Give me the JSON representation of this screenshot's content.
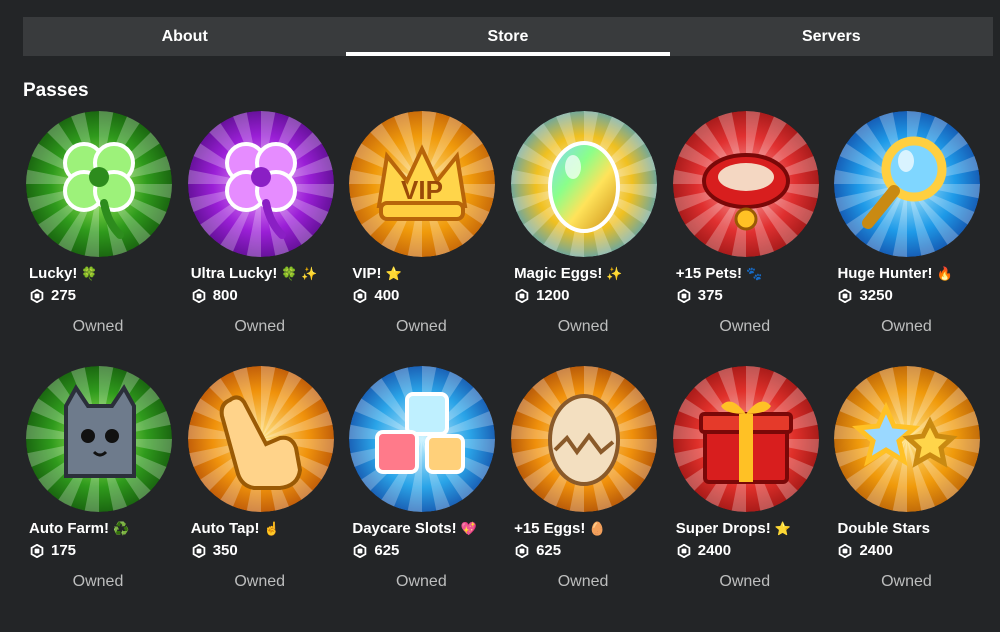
{
  "tabs": [
    {
      "label": "About",
      "active": false
    },
    {
      "label": "Store",
      "active": true
    },
    {
      "label": "Servers",
      "active": false
    }
  ],
  "section_title": "Passes",
  "currency_icon": "robux-icon",
  "owned_label": "Owned",
  "passes": [
    {
      "name": "Lucky!",
      "emoji": "🍀",
      "price": "275",
      "icon": "green-clover-icon",
      "colors": [
        "#b7ff6a",
        "#2f9a1c",
        "#0f4a0a"
      ]
    },
    {
      "name": "Ultra Lucky!",
      "emoji": "🍀 ✨",
      "price": "800",
      "icon": "purple-clover-icon",
      "colors": [
        "#f3a6ff",
        "#9a1fd6",
        "#4a0a7a"
      ]
    },
    {
      "name": "VIP!",
      "emoji": "⭐",
      "price": "400",
      "icon": "vip-crown-icon",
      "colors": [
        "#ffe58a",
        "#f09a0b",
        "#b4520a"
      ]
    },
    {
      "name": "Magic Eggs!",
      "emoji": "✨",
      "price": "1200",
      "icon": "rainbow-egg-icon",
      "colors": [
        "#ffffff",
        "#f0c020",
        "#2a9ae0"
      ]
    },
    {
      "name": "+15 Pets!",
      "emoji": "🐾",
      "price": "375",
      "icon": "pet-collar-icon",
      "colors": [
        "#ffb0b0",
        "#e03030",
        "#8a1010"
      ]
    },
    {
      "name": "Huge Hunter!",
      "emoji": "🔥",
      "price": "3250",
      "icon": "magnifying-glass-icon",
      "colors": [
        "#bff3ff",
        "#1e9ae8",
        "#123c9a"
      ]
    },
    {
      "name": "Auto Farm!",
      "emoji": "♻️",
      "price": "175",
      "icon": "cat-pet-icon",
      "colors": [
        "#b7ff6a",
        "#2f9a1c",
        "#0f4a0a"
      ]
    },
    {
      "name": "Auto Tap!",
      "emoji": "☝️",
      "price": "350",
      "icon": "tapping-hand-icon",
      "colors": [
        "#ffe58a",
        "#f0920b",
        "#a8420a"
      ]
    },
    {
      "name": "Daycare Slots!",
      "emoji": "💖",
      "price": "625",
      "icon": "daycare-blocks-icon",
      "colors": [
        "#c9f3ff",
        "#2aa4e8",
        "#123c9a"
      ]
    },
    {
      "name": "+15 Eggs!",
      "emoji": "🥚",
      "price": "625",
      "icon": "cracked-egg-icon",
      "colors": [
        "#ffe28a",
        "#f0900b",
        "#9a3e0a"
      ]
    },
    {
      "name": "Super Drops!",
      "emoji": "⭐",
      "price": "2400",
      "icon": "gift-box-icon",
      "colors": [
        "#ffb0a0",
        "#e0302a",
        "#8a1010"
      ]
    },
    {
      "name": "Double Stars",
      "emoji": "",
      "price": "2400",
      "icon": "double-stars-icon",
      "colors": [
        "#ffe58a",
        "#f09a0b",
        "#a8520a"
      ]
    }
  ]
}
